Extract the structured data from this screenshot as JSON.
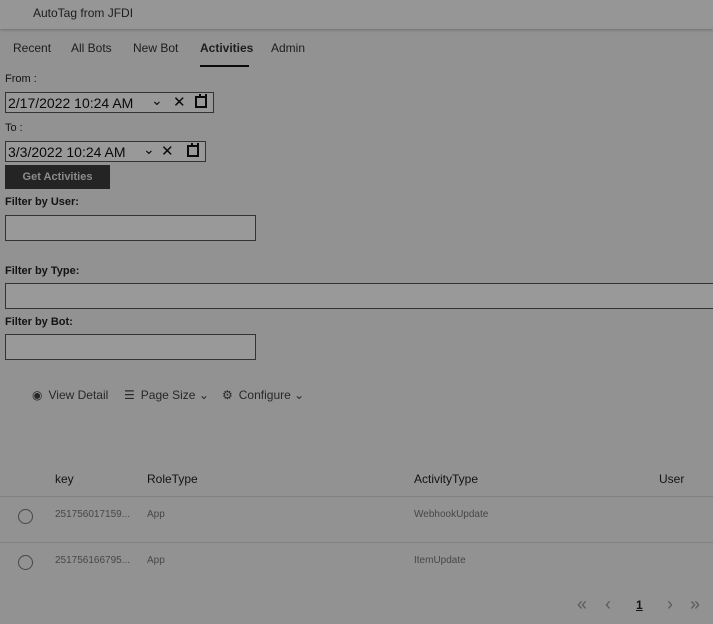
{
  "app": {
    "title": "AutoTag from JFDI"
  },
  "tabs": [
    {
      "label": "Recent"
    },
    {
      "label": "All Bots"
    },
    {
      "label": "New Bot"
    },
    {
      "label": "Activities",
      "active": true
    },
    {
      "label": "Admin"
    }
  ],
  "filters": {
    "from_label": "From :",
    "from_value": "2/17/2022 10:24  AM",
    "to_label": "To :",
    "to_value": "3/3/2022 10:24  AM",
    "get_button": "Get Activities",
    "user_label": "Filter by User:",
    "user_value": "",
    "type_label": "Filter by Type:",
    "type_value": "",
    "bot_label": "Filter by Bot:",
    "bot_value": ""
  },
  "toolbar": {
    "view_detail": "View Detail",
    "page_size": "Page Size",
    "configure": "Configure"
  },
  "table": {
    "columns": [
      "key",
      "RoleType",
      "ActivityType",
      "User"
    ],
    "rows": [
      {
        "key": "251756017159...",
        "role_type": "App",
        "activity_type": "WebhookUpdate",
        "user": ""
      },
      {
        "key": "251756166795...",
        "role_type": "App",
        "activity_type": "ItemUpdate",
        "user": ""
      }
    ]
  },
  "pager": {
    "current_page": "1"
  }
}
